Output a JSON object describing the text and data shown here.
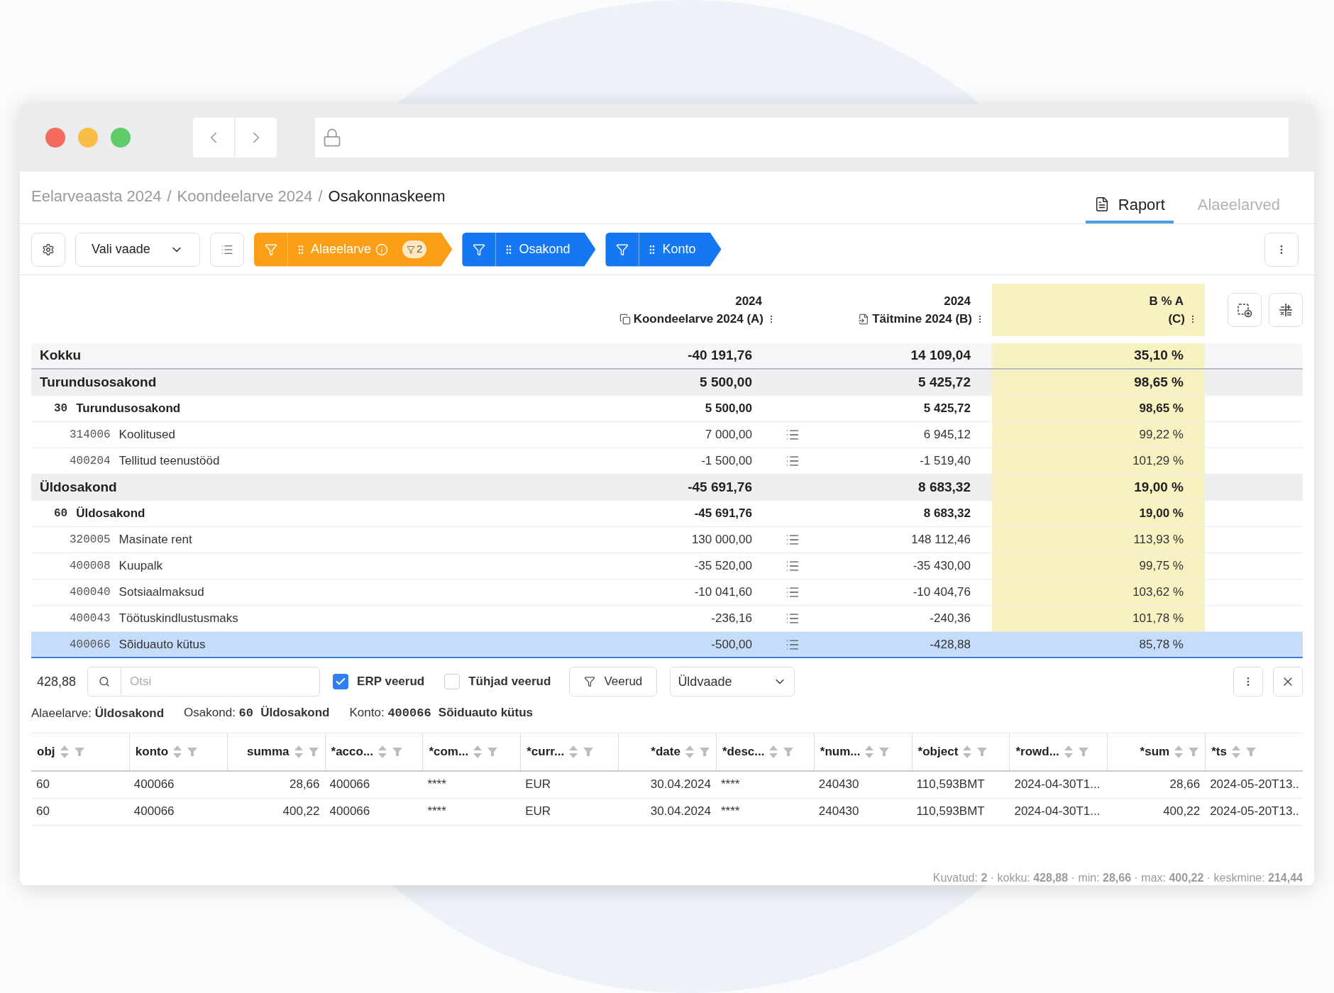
{
  "breadcrumb": {
    "separator": "/",
    "items": [
      "Eelarveaasta 2024",
      "Koondeelarve 2024",
      "Osakonnaskeem"
    ]
  },
  "tabs": [
    {
      "label": "Raport",
      "selected": true
    },
    {
      "label": "Alaeelarved",
      "selected": false
    }
  ],
  "toolbar": {
    "view_select": "Vali vaade",
    "filters": [
      {
        "label": "Alaeelarve",
        "color": "#fb9f16",
        "info": true,
        "count": "2"
      },
      {
        "label": "Osakond",
        "color": "#1677f2",
        "info": false
      },
      {
        "label": "Konto",
        "color": "#1677f2",
        "info": false
      }
    ]
  },
  "report": {
    "columns": [
      {
        "year": "2024",
        "title": "Koondeelarve 2024 (A)",
        "kind": "plan"
      },
      {
        "year": "2024",
        "title": "Täitmine 2024 (B)",
        "kind": "actual"
      },
      {
        "line1": "B % A",
        "line2": "(C)",
        "kind": "ratio"
      }
    ],
    "rows": [
      {
        "kind": "total",
        "label": "Kokku",
        "a": "-40 191,76",
        "b": "14 109,04",
        "c": "35,10 %",
        "selected": false
      },
      {
        "kind": "group",
        "label": "Turundusosakond",
        "a": "5 500,00",
        "b": "5 425,72",
        "c": "98,65 %",
        "selected": false,
        "children": [
          {
            "kind": "group",
            "code": "30",
            "label": "Turundusosakond",
            "a": "5 500,00",
            "b": "5 425,72",
            "c": "98,65 %",
            "selected": false,
            "children": [
              {
                "kind": "account",
                "code": "314006",
                "label": "Koolitused",
                "a": "7 000,00",
                "b": "6 945,12",
                "c": "99,22 %",
                "selected": false
              },
              {
                "kind": "account",
                "code": "400204",
                "label": "Tellitud teenustööd",
                "a": "-1 500,00",
                "b": "-1 519,40",
                "c": "101,29 %",
                "selected": false
              }
            ]
          }
        ]
      },
      {
        "kind": "group",
        "label": "Üldosakond",
        "a": "-45 691,76",
        "b": "8 683,32",
        "c": "19,00 %",
        "selected": false,
        "children": [
          {
            "kind": "group",
            "code": "60",
            "label": "Üldosakond",
            "a": "-45 691,76",
            "b": "8 683,32",
            "c": "19,00 %",
            "selected": false,
            "children": [
              {
                "kind": "account",
                "code": "320005",
                "label": "Masinate rent",
                "a": "130 000,00",
                "b": "148 112,46",
                "c": "113,93 %",
                "selected": false
              },
              {
                "kind": "account",
                "code": "400008",
                "label": "Kuupalk",
                "a": "-35 520,00",
                "b": "-35 430,00",
                "c": "99,75 %",
                "selected": false
              },
              {
                "kind": "account",
                "code": "400040",
                "label": "Sotsiaalmaksud",
                "a": "-10 041,60",
                "b": "-10 404,76",
                "c": "103,62 %",
                "selected": false
              },
              {
                "kind": "account",
                "code": "400043",
                "label": "Töötuskindlustusmaks",
                "a": "-236,16",
                "b": "-240,36",
                "c": "101,78 %",
                "selected": false
              },
              {
                "kind": "account",
                "code": "400066",
                "label": "Sõiduauto kütus",
                "a": "-500,00",
                "b": "-428,88",
                "c": "85,78 %",
                "selected": true
              }
            ]
          }
        ]
      }
    ]
  },
  "detail": {
    "total": "428,88",
    "search": {
      "placeholder": "Otsi"
    },
    "checkboxes": [
      {
        "label": "ERP veerud",
        "checked": true
      },
      {
        "label": "Tühjad veerud",
        "checked": false
      }
    ],
    "columns_button": "Veerud",
    "view_select": "Üldvaade",
    "filters": [
      {
        "label": "Alaeelarve:",
        "value": "Üldosakond"
      },
      {
        "label": "Osakond:",
        "code": "60",
        "value": "Üldosakond"
      },
      {
        "label": "Konto:",
        "code": "400066",
        "value": "Sõiduauto kütus"
      }
    ],
    "table": {
      "columns": [
        {
          "label": "obj",
          "kind": "text"
        },
        {
          "label": "konto",
          "kind": "text"
        },
        {
          "label": "summa",
          "kind": "number"
        },
        {
          "label": "*acco...",
          "kind": "text"
        },
        {
          "label": "*com...",
          "kind": "text"
        },
        {
          "label": "*curr...",
          "kind": "text"
        },
        {
          "label": "*date",
          "kind": "number"
        },
        {
          "label": "*desc...",
          "kind": "text"
        },
        {
          "label": "*num...",
          "kind": "text"
        },
        {
          "label": "*object",
          "kind": "text"
        },
        {
          "label": "*rowd...",
          "kind": "text"
        },
        {
          "label": "*sum",
          "kind": "number"
        },
        {
          "label": "*ts",
          "kind": "text"
        }
      ],
      "rows": [
        [
          "60",
          "400066",
          "28,66",
          "400066",
          "****",
          "EUR",
          "30.04.2024",
          "****",
          "240430",
          "110,593BMT",
          "2024-04-30T1...",
          "28,66",
          "2024-05-20T13.."
        ],
        [
          "60",
          "400066",
          "400,22",
          "400066",
          "****",
          "EUR",
          "30.04.2024",
          "****",
          "240430",
          "110,593BMT",
          "2024-04-30T1...",
          "400,22",
          "2024-05-20T13.."
        ]
      ]
    },
    "summary": "Kuvatud: **2** · kokku: **428,88** · min: **28,66** · max: **400,22** · keskmine: **214,44**"
  }
}
